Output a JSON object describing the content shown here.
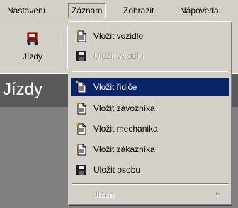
{
  "menubar": {
    "items": [
      {
        "label": "Nastavení"
      },
      {
        "label": "Záznam"
      },
      {
        "label": "Zobrazit"
      },
      {
        "label": "Nápověda"
      }
    ]
  },
  "toolbar": {
    "jizdy_label": "Jízdy"
  },
  "header": {
    "title": "Jízdy"
  },
  "dropdown": {
    "items": [
      {
        "label": "Vložit vozidlo",
        "icon": "new-document-icon",
        "enabled": true
      },
      {
        "label": "Uložit vozidlo",
        "icon": "floppy-disk-icon",
        "enabled": false
      },
      {
        "label": "Vložit řidiče",
        "icon": "new-document-icon",
        "enabled": true,
        "highlighted": true
      },
      {
        "label": "Vložit závozníka",
        "icon": "new-document-icon",
        "enabled": true
      },
      {
        "label": "Vložit mechanika",
        "icon": "new-document-icon",
        "enabled": true
      },
      {
        "label": "Vložit zákazníka",
        "icon": "new-document-icon",
        "enabled": true
      },
      {
        "label": "Uložit osobu",
        "icon": "floppy-disk-icon",
        "enabled": true
      },
      {
        "label": "Jízda",
        "enabled": false,
        "submenu_arrow": "▸"
      }
    ]
  },
  "colors": {
    "highlight": "#0a246a",
    "face": "#d4d0c8",
    "header_bar": "#5a5a5a"
  }
}
